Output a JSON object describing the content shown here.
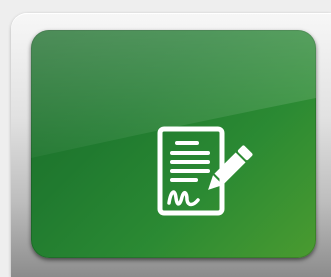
{
  "tile": {
    "icon": "document-sign-icon",
    "accent_color": "#2b8a33",
    "icon_color": "#ffffff"
  }
}
